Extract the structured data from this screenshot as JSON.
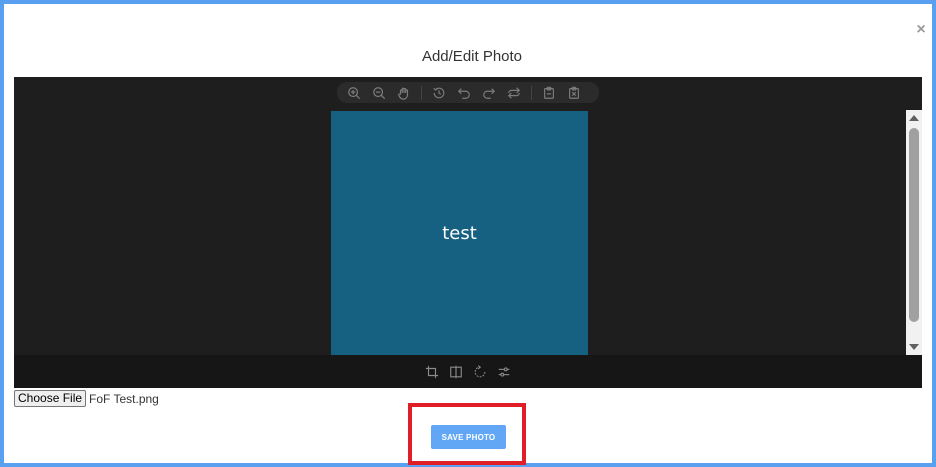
{
  "modal": {
    "title": "Add/Edit Photo",
    "close_label": "×"
  },
  "editor": {
    "canvas_text": "test",
    "canvas_color": "#166182",
    "top_toolbar_icons": [
      "zoom-in-icon",
      "zoom-out-icon",
      "pan-hand-icon",
      "history-icon",
      "undo-icon",
      "redo-icon",
      "redo-all-icon",
      "clipboard-icon",
      "delete-icon"
    ],
    "bottom_toolbar_icons": [
      "crop-icon",
      "flip-icon",
      "rotate-icon",
      "adjust-icon"
    ]
  },
  "file_input": {
    "button_label": "Choose File",
    "file_name": "FoF Test.png"
  },
  "actions": {
    "save_label": "SAVE PHOTO"
  },
  "colors": {
    "frame_border": "#5aa0f0",
    "save_button": "#62a7f6",
    "highlight": "#e01e28",
    "editor_bg": "#1e1e1e"
  }
}
